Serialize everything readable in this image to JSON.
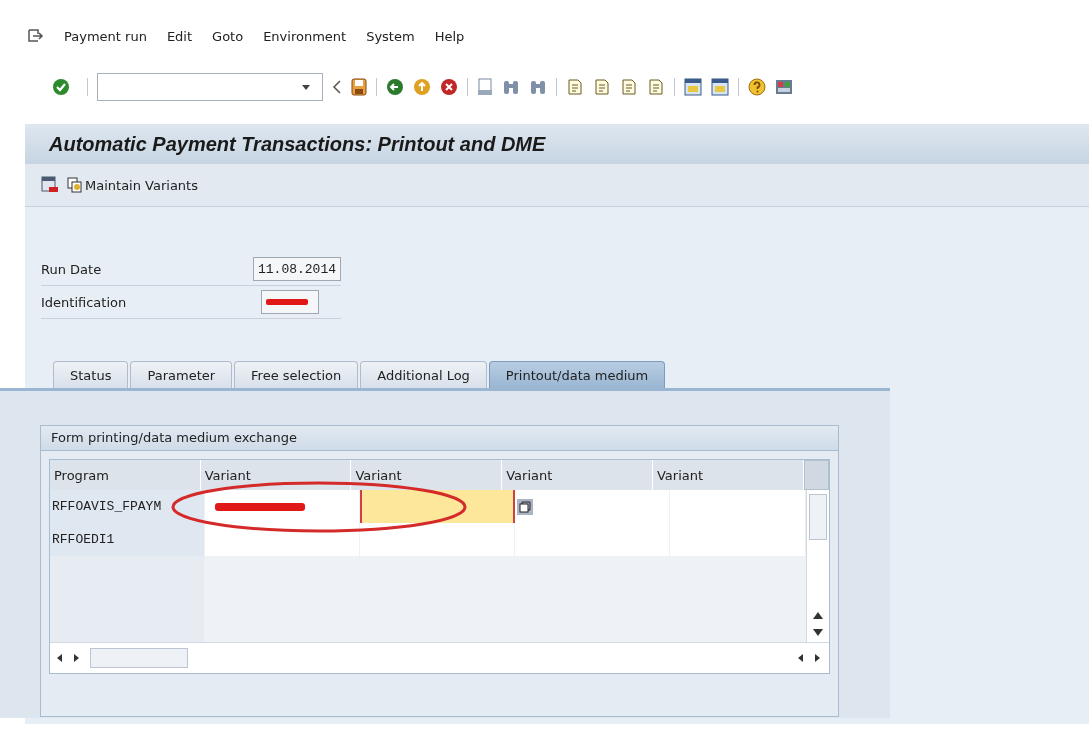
{
  "menu": [
    "Payment run",
    "Edit",
    "Goto",
    "Environment",
    "System",
    "Help"
  ],
  "title": "Automatic Payment Transactions: Printout and DME",
  "app_toolbar": {
    "button": "Maintain Variants"
  },
  "fields": [
    {
      "label": "Run Date",
      "value": "11.08.2014",
      "redacted": false
    },
    {
      "label": "Identification",
      "redacted": true
    }
  ],
  "tabs": [
    {
      "label": "Status",
      "selected": false
    },
    {
      "label": "Parameter",
      "selected": false
    },
    {
      "label": "Free selection",
      "selected": false
    },
    {
      "label": "Additional Log",
      "selected": false
    },
    {
      "label": "Printout/data medium",
      "selected": true
    }
  ],
  "group": {
    "title": "Form printing/data medium exchange",
    "columns": [
      "Program",
      "Variant",
      "Variant",
      "Variant",
      "Variant"
    ],
    "rows": [
      {
        "program": "RFFOAVIS_FPAYM",
        "variant_redacted": true,
        "input_focused": true
      },
      {
        "program": "RFFOEDI1",
        "variant_redacted": false,
        "input_focused": false
      }
    ]
  },
  "annotation": {
    "kind": "ellipse",
    "color": "#d42a2a"
  }
}
